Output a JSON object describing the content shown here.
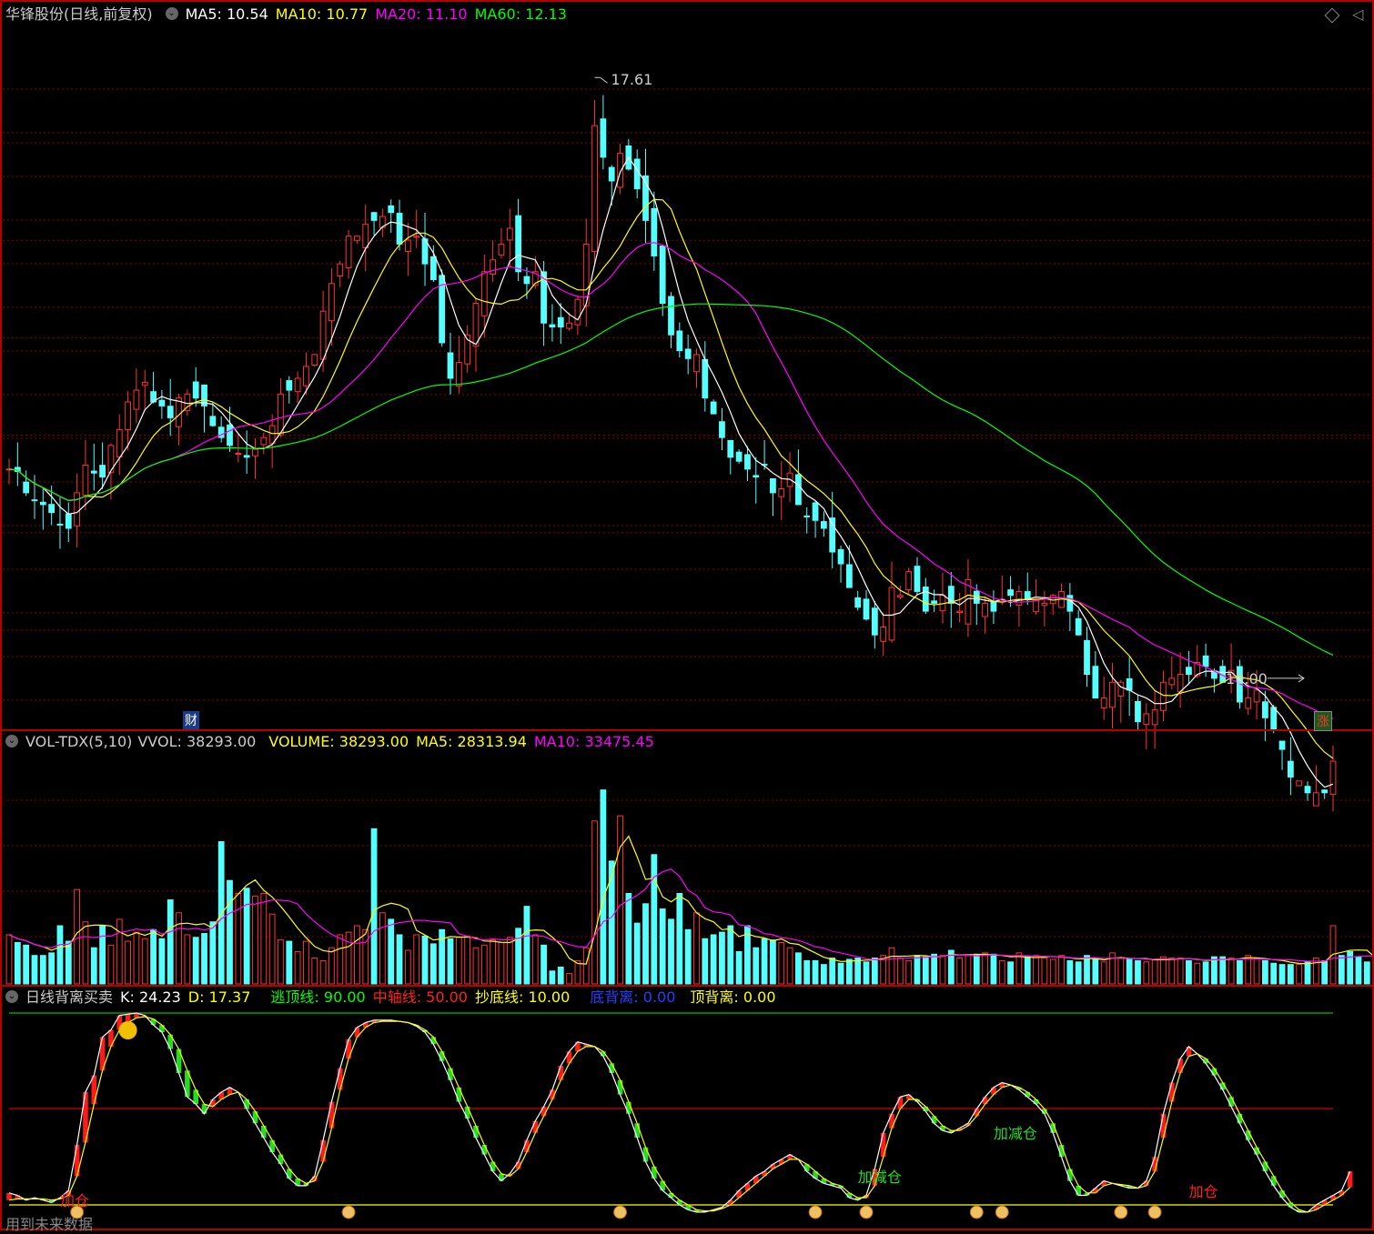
{
  "main_legend": {
    "title": "华锋股份(日线,前复权)",
    "ma5": "MA5: 10.54",
    "ma10": "MA10: 10.77",
    "ma20": "MA20: 11.10",
    "ma60": "MA60: 12.13"
  },
  "main_annotations": {
    "high_label": "17.61",
    "low_label": "10.00",
    "fin_tag": "财",
    "limit_tag": "涨"
  },
  "vol_legend": {
    "name": "VOL-TDX(5,10)",
    "vvol": "VVOL: 38293.00",
    "volume": "VOLUME: 38293.00",
    "ma5": "MA5: 28313.94",
    "ma10": "MA10: 33475.45"
  },
  "ind_legend": {
    "name": "日线背离买卖",
    "k": "K: 24.23",
    "d": "D: 17.37",
    "escape": "逃顶线: 90.00",
    "mid": "中轴线: 50.00",
    "bottom": "抄底线: 10.00",
    "bot_div": "底背离: 0.00",
    "top_div": "顶背离: 0.00"
  },
  "indicator_labels": [
    "加仓",
    "加减仓",
    "加减仓",
    "加仓"
  ],
  "footer": "用到未来数据",
  "colors": {
    "up": "#ff3232",
    "down": "#54ffff",
    "ma5": "#ffffff",
    "ma10": "#ffff00",
    "ma20": "#ff00ff",
    "ma60": "#00ff00",
    "grid": "#8b0000",
    "frame": "#b40000"
  },
  "chart_data": [
    {
      "type": "candlestick",
      "title": "华锋股份(日线,前复权)",
      "ylim": [
        9.4,
        18.2
      ],
      "marked_high": 17.61,
      "marked_low": 10.0,
      "closes": [
        12.65,
        12.62,
        12.35,
        12.25,
        12.2,
        12.1,
        11.95,
        11.9,
        12.35,
        12.7,
        12.6,
        12.55,
        12.95,
        13.15,
        13.5,
        13.65,
        13.75,
        13.5,
        13.45,
        13.3,
        13.55,
        13.6,
        13.55,
        13.45,
        13.2,
        13.05,
        12.95,
        12.85,
        12.8,
        12.9,
        13.05,
        13.2,
        13.6,
        13.65,
        13.8,
        13.95,
        14.1,
        14.65,
        15.0,
        15.25,
        15.6,
        15.6,
        15.75,
        15.8,
        15.85,
        15.9,
        15.5,
        15.55,
        15.6,
        15.25,
        15.05,
        14.25,
        13.8,
        14.0,
        14.35,
        14.75,
        15.15,
        15.3,
        15.5,
        15.7,
        15.15,
        15.0,
        15.15,
        14.5,
        14.45,
        14.45,
        14.5,
        14.8,
        15.5,
        17.0,
        16.6,
        16.3,
        16.65,
        16.45,
        16.2,
        15.8,
        15.35,
        14.75,
        14.35,
        14.15,
        14.05,
        14.1,
        13.55,
        13.35,
        13.05,
        12.8,
        12.75,
        12.65,
        12.55,
        12.7,
        12.35,
        12.4,
        12.6,
        12.2,
        12.05,
        12.0,
        11.9,
        11.6,
        11.45,
        11.15,
        10.9,
        10.75,
        10.55,
        10.65,
        11.15,
        11.05,
        11.35,
        11.1,
        10.85,
        10.95,
        11.05,
        10.95,
        10.85,
        11.25,
        10.95,
        10.95,
        10.85,
        11.0,
        11.05,
        11.1,
        11.0,
        11.0,
        10.95,
        11.05,
        11.1,
        10.85,
        10.55,
        10.05,
        9.75,
        9.75,
        9.95,
        9.95,
        9.85,
        9.45,
        9.55,
        9.6,
        9.95,
        10.0,
        10.05,
        10.05,
        10.2,
        10.15,
        10.0,
        9.95,
        10.1,
        9.7,
        9.75,
        9.85,
        9.5,
        9.35,
        9.1,
        8.75,
        8.7,
        8.55,
        8.55,
        8.55,
        8.95
      ]
    },
    {
      "type": "bar",
      "title": "VOL-TDX(5,10)",
      "series_names": [
        "VOLUME",
        "MA5",
        "MA10"
      ],
      "latest": {
        "VOLUME": 38293.0,
        "MA5": 28313.94,
        "MA10": 33475.45
      },
      "ylim": [
        0,
        180000
      ],
      "values": [
        38000,
        32000,
        30000,
        22000,
        22000,
        24000,
        45000,
        33000,
        73000,
        48000,
        28000,
        45000,
        30000,
        50000,
        33000,
        40000,
        35000,
        42000,
        35000,
        65000,
        55000,
        38000,
        36000,
        39000,
        48000,
        110000,
        80000,
        70000,
        74000,
        68000,
        70000,
        54000,
        34000,
        33000,
        25000,
        33000,
        20000,
        18000,
        28000,
        38000,
        40000,
        45000,
        42000,
        120000,
        55000,
        50000,
        38000,
        26000,
        38000,
        37000,
        31000,
        42000,
        35000,
        36000,
        37000,
        28000,
        30000,
        34000,
        32000,
        36000,
        43000,
        60000,
        38000,
        30000,
        10000,
        13000,
        8000,
        18000,
        28000,
        126000,
        150000,
        95000,
        130000,
        70000,
        47000,
        62000,
        100000,
        58000,
        50000,
        70000,
        42000,
        55000,
        35000,
        38000,
        40000,
        45000,
        25000,
        45000,
        28000,
        35000,
        34000,
        32000,
        28000,
        24000,
        18000,
        18000,
        15000,
        20000,
        16000,
        19000,
        20000,
        17000,
        20000,
        22000,
        28000,
        20000,
        18000,
        22000,
        21000,
        23000,
        22000,
        26000,
        20000,
        22000,
        23000,
        24000,
        23000,
        18000,
        17000,
        24000,
        21000,
        22000,
        20000,
        19000,
        22000,
        18000,
        17000,
        22000,
        19000,
        17000,
        24000,
        20000,
        19000,
        18000,
        17000,
        19000,
        21000,
        20000,
        20000,
        18000,
        16000,
        17000,
        21000,
        21000,
        20000,
        18000,
        22000,
        20000,
        18000,
        16000,
        15000,
        15000,
        15000,
        17000,
        20000,
        18000,
        45000,
        22000,
        25000,
        21000,
        17000,
        17000,
        22000,
        38293
      ]
    },
    {
      "type": "line",
      "title": "日线背离买卖",
      "series_names": [
        "K",
        "D"
      ],
      "ylim": [
        0,
        100
      ],
      "reference_lines": {
        "逃顶线": 90,
        "中轴线": 50,
        "抄底线": 10
      },
      "latest": {
        "K": 24.23,
        "D": 17.37
      },
      "k_values": [
        15.0,
        14.0,
        12.0,
        13.0,
        12.0,
        11.0,
        13.0,
        16.0,
        35.0,
        57.0,
        64.0,
        80.0,
        83.0,
        89.0,
        89.5,
        90.0,
        89.0,
        85.0,
        82.0,
        75.0,
        65.0,
        55.0,
        52.0,
        48.0,
        54.0,
        57.0,
        59.0,
        57.0,
        50.0,
        44.0,
        38.0,
        32.0,
        27.0,
        21.0,
        18.0,
        18.0,
        22.0,
        37.0,
        53.0,
        67.0,
        79.0,
        84.0,
        86.0,
        87.0,
        87.0,
        87.0,
        86.5,
        86.0,
        84.5,
        82.0,
        77.0,
        70.0,
        62.0,
        53.0,
        46.0,
        38.0,
        31.0,
        24.0,
        20.0,
        23.0,
        28.0,
        37.0,
        45.0,
        51.0,
        58.0,
        68.0,
        74.0,
        78.0,
        77.0,
        76.0,
        72.0,
        65.0,
        56.0,
        48.0,
        38.0,
        28.0,
        21.0,
        16.0,
        13.0,
        10.0,
        8.0,
        7.0,
        7.0,
        8.0,
        9.0,
        12.0,
        16.0,
        19.0,
        22.0,
        24.0,
        27.0,
        29.0,
        31.0,
        29.0,
        24.0,
        21.0,
        19.0,
        18.0,
        17.0,
        13.0,
        12.0,
        14.0,
        25.0,
        40.0,
        48.0,
        55.0,
        56.0,
        53.0,
        49.0,
        44.0,
        41.0,
        40.0,
        42.0,
        44.0,
        50.0,
        55.0,
        59.0,
        61.0,
        60.0,
        58.0,
        55.0,
        52.0,
        48.0,
        40.0,
        30.0,
        20.0,
        14.0,
        14.0,
        17.0,
        20.0,
        19.0,
        18.0,
        17.0,
        17.0,
        20.0,
        30.0,
        48.0,
        61.0,
        71.0,
        76.0,
        73.0,
        69.0,
        64.0,
        58.0,
        51.0,
        44.0,
        37.0,
        31.0,
        24.0,
        18.0,
        13.0,
        9.0,
        7.0,
        7.0,
        10.0,
        12.0,
        14.0,
        16.0,
        24.0
      ],
      "d_values": [
        12.0,
        12.5,
        12.5,
        12.5,
        12.5,
        12.0,
        12.5,
        14.0,
        22.0,
        36.0,
        52.0,
        66.0,
        76.0,
        83.0,
        86.0,
        88.0,
        88.5,
        87.5,
        85.0,
        81.0,
        75.0,
        66.0,
        58.0,
        52.0,
        51.0,
        54.0,
        56.0,
        57.0,
        54.0,
        49.0,
        43.0,
        37.0,
        31.0,
        25.0,
        21.0,
        19.0,
        20.0,
        28.0,
        42.0,
        58.0,
        71.0,
        80.0,
        84.0,
        86.0,
        86.5,
        86.5,
        86.5,
        86.0,
        85.0,
        83.0,
        80.0,
        74.0,
        67.0,
        59.0,
        51.0,
        43.0,
        35.0,
        28.0,
        23.0,
        22.0,
        25.0,
        32.0,
        40.0,
        47.0,
        54.0,
        62.0,
        69.0,
        74.0,
        76.0,
        76.0,
        74.0,
        69.0,
        62.0,
        53.0,
        44.0,
        34.0,
        26.0,
        20.0,
        15.0,
        12.0,
        10.0,
        8.0,
        7.5,
        7.5,
        8.5,
        10.0,
        13.0,
        16.0,
        19.0,
        22.0,
        25.0,
        27.0,
        29.0,
        29.0,
        27.0,
        24.0,
        21.0,
        19.0,
        18.0,
        15.0,
        13.0,
        13.0,
        18.0,
        30.0,
        42.0,
        50.0,
        54.0,
        54.0,
        51.0,
        47.0,
        43.0,
        41.0,
        41.0,
        43.0,
        47.0,
        52.0,
        56.0,
        59.0,
        60.0,
        59.0,
        57.0,
        54.0,
        50.0,
        44.0,
        35.0,
        25.0,
        18.0,
        15.0,
        15.0,
        18.0,
        19.0,
        18.5,
        18.0,
        17.0,
        18.0,
        24.0,
        38.0,
        53.0,
        65.0,
        72.0,
        73.0,
        71.0,
        67.0,
        61.0,
        55.0,
        48.0,
        41.0,
        34.0,
        28.0,
        22.0,
        16.0,
        11.0,
        8.0,
        7.0,
        8.0,
        10.0,
        12.0,
        14.0,
        17.37
      ],
      "buy_markers": [
        8,
        40,
        72,
        95,
        101,
        114,
        117,
        131,
        135,
        162
      ]
    }
  ]
}
